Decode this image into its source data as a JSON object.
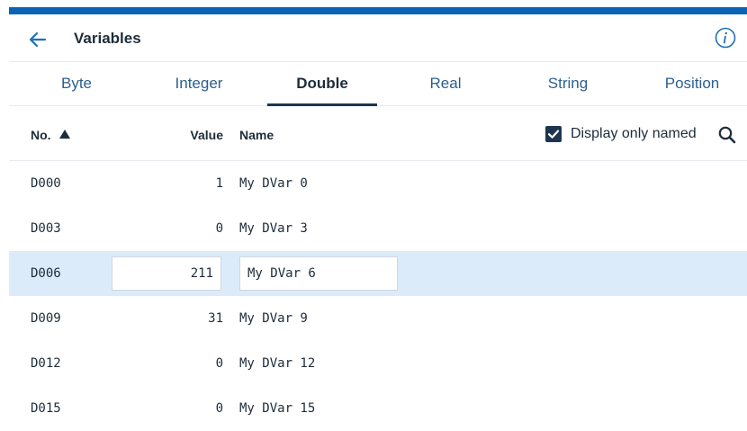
{
  "header": {
    "title": "Variables",
    "back_icon": "arrow-left-icon",
    "info_icon": "info-icon"
  },
  "tabs": [
    {
      "label": "Byte"
    },
    {
      "label": "Integer"
    },
    {
      "label": "Double",
      "active": true
    },
    {
      "label": "Real"
    },
    {
      "label": "String"
    },
    {
      "label": "Position"
    }
  ],
  "table": {
    "columns": {
      "no": "No.",
      "value": "Value",
      "name": "Name"
    },
    "sort_icon": "sort-up-icon",
    "filter": {
      "label": "Display only named",
      "checked": true
    },
    "search_icon": "search-icon",
    "rows": [
      {
        "no": "D000",
        "value": "1",
        "name": "My DVar 0"
      },
      {
        "no": "D003",
        "value": "0",
        "name": "My DVar 3"
      },
      {
        "no": "D006",
        "value": "211",
        "name": "My DVar 6",
        "editing": true
      },
      {
        "no": "D009",
        "value": "31",
        "name": "My DVar 9"
      },
      {
        "no": "D012",
        "value": "0",
        "name": "My DVar 12"
      },
      {
        "no": "D015",
        "value": "0",
        "name": "My DVar 15"
      }
    ]
  },
  "colors": {
    "accent_bar": "#0a63b3",
    "selected_row": "#dcebf9",
    "tab_text": "#2c5f8f",
    "dark": "#1e2c3a"
  }
}
